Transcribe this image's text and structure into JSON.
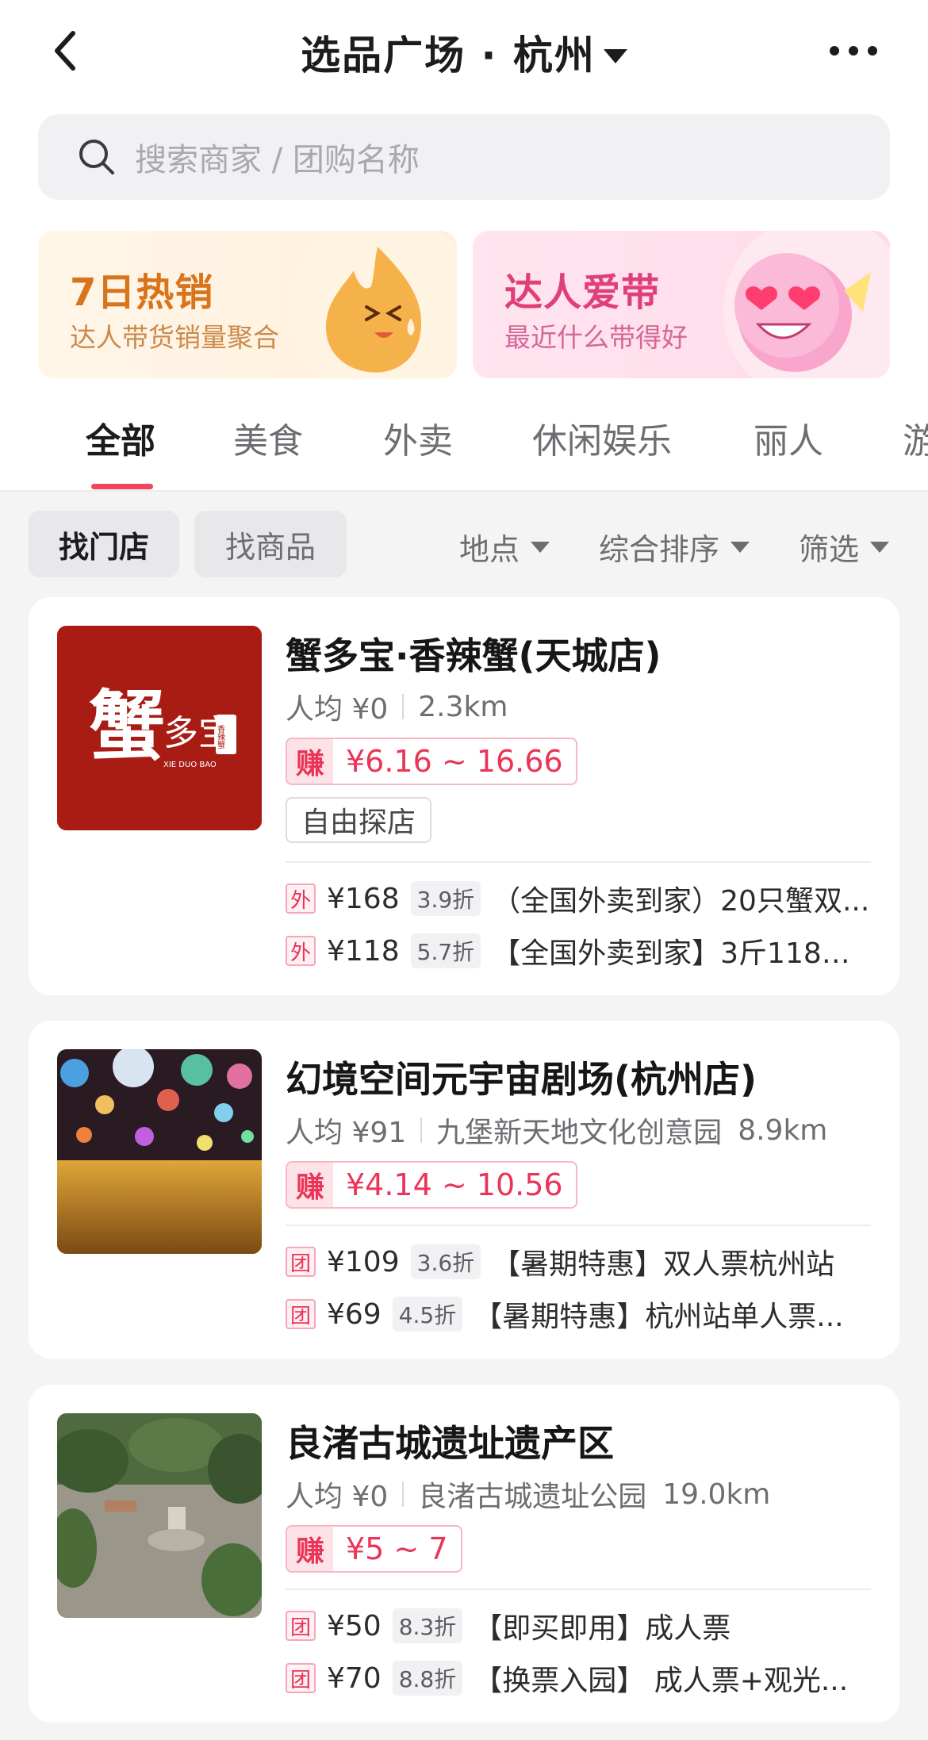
{
  "header": {
    "title": "选品广场 · 杭州"
  },
  "search": {
    "placeholder": "搜索商家 / 团购名称"
  },
  "banners": [
    {
      "title": "7日热销",
      "subtitle": "达人带货销量聚合"
    },
    {
      "title": "达人爱带",
      "subtitle": "最近什么带得好"
    }
  ],
  "tabs": [
    "全部",
    "美食",
    "外卖",
    "休闲娱乐",
    "丽人",
    "游"
  ],
  "filters": {
    "segments": [
      "找门店",
      "找商品"
    ],
    "dropdowns": [
      "地点",
      "综合排序",
      "筛选"
    ]
  },
  "stores": [
    {
      "name": "蟹多宝·香辣蟹(天城店)",
      "avg": "人均 ¥0",
      "place": "",
      "distance": "2.3km",
      "earn_tag": "赚",
      "earn": "¥6.16 ~ 16.66",
      "chip": "自由探店",
      "logo_big": "蟹",
      "logo_small": "多宝",
      "logo_seal": "香辣蟹",
      "logo_pinyin": "XIE DUO BAO",
      "deals": [
        {
          "kind": "外",
          "price": "¥168",
          "discount": "3.9折",
          "name": "（全国外卖到家）20只蟹双..."
        },
        {
          "kind": "外",
          "price": "¥118",
          "discount": "5.7折",
          "name": "【全国外卖到家】3斤118元..."
        }
      ]
    },
    {
      "name": "幻境空间元宇宙剧场(杭州店)",
      "avg": "人均 ¥91",
      "place": "九堡新天地文化创意园",
      "distance": "8.9km",
      "earn_tag": "赚",
      "earn": "¥4.14 ~ 10.56",
      "deals": [
        {
          "kind": "团",
          "price": "¥109",
          "discount": "3.6折",
          "name": "【暑期特惠】双人票杭州站"
        },
        {
          "kind": "团",
          "price": "¥69",
          "discount": "4.5折",
          "name": "【暑期特惠】杭州站单人票..."
        }
      ]
    },
    {
      "name": "良渚古城遗址遗产区",
      "avg": "人均 ¥0",
      "place": "良渚古城遗址公园",
      "distance": "19.0km",
      "earn_tag": "赚",
      "earn": "¥5 ~ 7",
      "deals": [
        {
          "kind": "团",
          "price": "¥50",
          "discount": "8.3折",
          "name": "【即买即用】成人票"
        },
        {
          "kind": "团",
          "price": "¥70",
          "discount": "8.8折",
          "name": "【换票入园】 成人票+观光..."
        }
      ]
    }
  ],
  "colors": {
    "accent": "#f0455d",
    "earn": "#ea3458",
    "hot_banner": "#d9741c",
    "love_banner": "#e0407a",
    "logo_bg": "#a81c14"
  }
}
